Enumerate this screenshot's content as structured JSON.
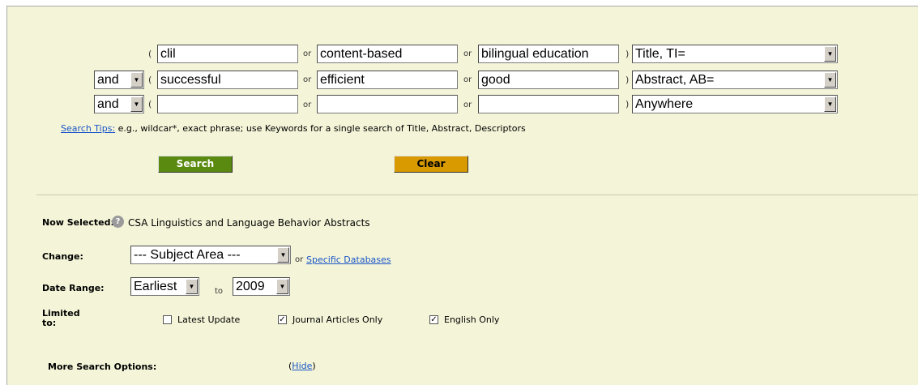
{
  "search_rows": [
    {
      "operator": "",
      "terms": [
        "clil",
        "content-based",
        "bilingual education"
      ],
      "field": "Title, TI="
    },
    {
      "operator": "and",
      "terms": [
        "successful",
        "efficient",
        "good"
      ],
      "field": "Abstract, AB="
    },
    {
      "operator": "and",
      "terms": [
        "",
        "",
        ""
      ],
      "field": "Anywhere"
    }
  ],
  "or_word": "or",
  "open_paren": "(",
  "close_paren": ")",
  "search_tips": {
    "link": "Search Tips:",
    "text": " e.g., wildcar*, exact phrase; use Keywords for a single search of Title, Abstract, Descriptors"
  },
  "buttons": {
    "search": "Search",
    "clear": "Clear"
  },
  "now_selected": {
    "label": "Now Selected:",
    "value": "CSA Linguistics and Language Behavior Abstracts"
  },
  "change": {
    "label": "Change:",
    "subject_area": "--- Subject Area ---",
    "or_word": "or",
    "specific_link": "Specific Databases"
  },
  "date_range": {
    "label": "Date Range:",
    "from": "Earliest",
    "to_word": "to",
    "to": "2009"
  },
  "limited_to": {
    "label_line1": "Limited",
    "label_line2": "to:",
    "options": [
      {
        "label": "Latest Update",
        "checked": false
      },
      {
        "label": "Journal Articles Only",
        "checked": true
      },
      {
        "label": "English Only",
        "checked": true
      }
    ]
  },
  "more_options": {
    "label": "More Search Options:",
    "open": "(",
    "link": "Hide",
    "close": ")"
  },
  "colors": {
    "panel_bg": "#f4f5d8",
    "search_button": "#5a8a10",
    "clear_button": "#d99a00",
    "link": "#1a55c9"
  }
}
